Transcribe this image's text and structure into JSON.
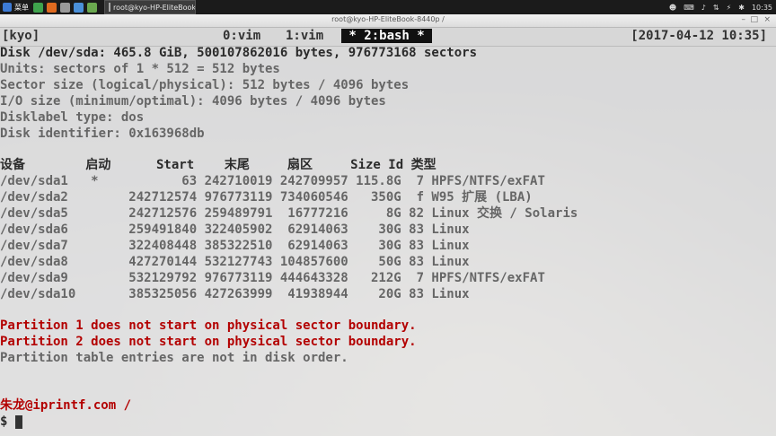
{
  "panel": {
    "menu_label": "菜单",
    "task_title": "root@kyo-HP-EliteBook-...",
    "clock": "10:35",
    "tray_icons": [
      "user-icon",
      "keyboard-icon",
      "volume-icon",
      "network-icon",
      "power-icon",
      "bluetooth-icon",
      "display-icon"
    ]
  },
  "window": {
    "title": "root@kyo-HP-EliteBook-8440p /",
    "controls": [
      "minimize",
      "maximize",
      "close"
    ]
  },
  "tmux": {
    "session": "[kyo]",
    "windows": [
      "0:vim",
      "1:vim",
      " * 2:bash * "
    ],
    "datetime": "[2017-04-12 10:35]"
  },
  "fdisk": {
    "header_lines": [
      "Disk /dev/sda: 465.8 GiB, 500107862016 bytes, 976773168 sectors",
      "Units: sectors of 1 * 512 = 512 bytes",
      "Sector size (logical/physical): 512 bytes / 4096 bytes",
      "I/O size (minimum/optimal): 4096 bytes / 4096 bytes",
      "Disklabel type: dos",
      "Disk identifier: 0x163968db"
    ],
    "table_header": "设备        启动      Start    末尾     扇区     Size Id 类型",
    "rows": [
      "/dev/sda1   *           63 242710019 242709957 115.8G  7 HPFS/NTFS/exFAT",
      "/dev/sda2        242712574 976773119 734060546   350G  f W95 扩展 (LBA)",
      "/dev/sda5        242712576 259489791  16777216     8G 82 Linux 交换 / Solaris",
      "/dev/sda6        259491840 322405902  62914063    30G 83 Linux",
      "/dev/sda7        322408448 385322510  62914063    30G 83 Linux",
      "/dev/sda8        427270144 532127743 104857600    50G 83 Linux",
      "/dev/sda9        532129792 976773119 444643328   212G  7 HPFS/NTFS/exFAT",
      "/dev/sda10       385325056 427263999  41938944    20G 83 Linux"
    ],
    "warnings": [
      "Partition 1 does not start on physical sector boundary.",
      "Partition 2 does not start on physical sector boundary."
    ],
    "notice": "Partition table entries are not in disk order."
  },
  "prompt": {
    "user_host": "朱龙@iprintf.com",
    "cwd": "/",
    "symbol": "$ "
  }
}
